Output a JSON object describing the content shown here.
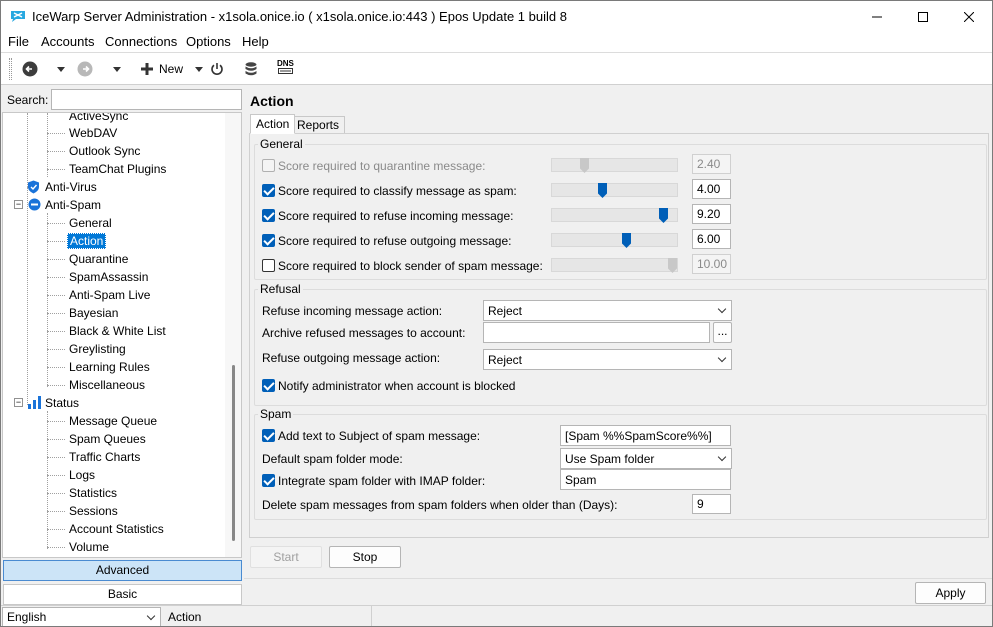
{
  "window": {
    "title": "IceWarp Server Administration - x1sola.onice.io ( x1sola.onice.io:443 ) Epos Update 1 build 8"
  },
  "menu": [
    "File",
    "Accounts",
    "Connections",
    "Options",
    "Help"
  ],
  "toolbar": {
    "new_label": "New",
    "dns_label": "DNS"
  },
  "search": {
    "label": "Search:",
    "value": ""
  },
  "tree": {
    "items": [
      {
        "label": "ActiveSync",
        "level": 2
      },
      {
        "label": "WebDAV",
        "level": 2
      },
      {
        "label": "Outlook Sync",
        "level": 2
      },
      {
        "label": "TeamChat Plugins",
        "level": 2
      },
      {
        "label": "Anti-Virus",
        "level": 1,
        "icon": "shield-icon"
      },
      {
        "label": "Anti-Spam",
        "level": 1,
        "icon": "no-entry-icon",
        "expanded": true
      },
      {
        "label": "General",
        "level": 2
      },
      {
        "label": "Action",
        "level": 2,
        "selected": true
      },
      {
        "label": "Quarantine",
        "level": 2
      },
      {
        "label": "SpamAssassin",
        "level": 2
      },
      {
        "label": "Anti-Spam Live",
        "level": 2
      },
      {
        "label": "Bayesian",
        "level": 2
      },
      {
        "label": "Black & White List",
        "level": 2
      },
      {
        "label": "Greylisting",
        "level": 2
      },
      {
        "label": "Learning Rules",
        "level": 2
      },
      {
        "label": "Miscellaneous",
        "level": 2
      },
      {
        "label": "Status",
        "level": 1,
        "icon": "bar-chart-icon",
        "expanded": true
      },
      {
        "label": "Message Queue",
        "level": 2
      },
      {
        "label": "Spam Queues",
        "level": 2
      },
      {
        "label": "Traffic Charts",
        "level": 2
      },
      {
        "label": "Logs",
        "level": 2
      },
      {
        "label": "Statistics",
        "level": 2
      },
      {
        "label": "Sessions",
        "level": 2
      },
      {
        "label": "Account Statistics",
        "level": 2
      },
      {
        "label": "Volume",
        "level": 2
      }
    ]
  },
  "mode_buttons": {
    "advanced": "Advanced",
    "basic": "Basic"
  },
  "page": {
    "title": "Action",
    "tabs": [
      "Action",
      "Reports"
    ],
    "active_tab": "Action"
  },
  "general": {
    "title": "General",
    "rows": [
      {
        "label": "Score required to quarantine message:",
        "checked": false,
        "disabled": true,
        "value": "2.40",
        "level": 0.24
      },
      {
        "label": "Score required to classify message as spam:",
        "checked": true,
        "disabled": false,
        "value": "4.00",
        "level": 0.4
      },
      {
        "label": "Score required to refuse incoming message:",
        "checked": true,
        "disabled": false,
        "value": "9.20",
        "level": 0.92
      },
      {
        "label": "Score required to refuse outgoing message:",
        "checked": true,
        "disabled": false,
        "value": "6.00",
        "level": 0.6
      },
      {
        "label": "Score required to block sender of spam message:",
        "checked": false,
        "disabled": false,
        "value": "10.00",
        "level": 1.0
      }
    ]
  },
  "refusal": {
    "title": "Refusal",
    "incoming_label": "Refuse incoming message action:",
    "incoming_value": "Reject",
    "archive_label": "Archive refused messages to account:",
    "archive_value": "",
    "browse_label": "...",
    "outgoing_label": "Refuse outgoing message action:",
    "outgoing_value": "Reject",
    "notify_label": "Notify administrator when account is blocked",
    "notify_checked": true
  },
  "spam": {
    "title": "Spam",
    "subject_label": "Add text to Subject of spam message:",
    "subject_checked": true,
    "subject_value": "[Spam %%SpamScore%%]",
    "folder_mode_label": "Default spam folder mode:",
    "folder_mode_value": "Use Spam folder",
    "imap_label": "Integrate spam folder with IMAP folder:",
    "imap_checked": true,
    "imap_value": "Spam",
    "delete_label": "Delete spam messages from spam folders when older than (Days):",
    "delete_value": "9"
  },
  "actions": {
    "start": "Start",
    "stop": "Stop",
    "apply": "Apply"
  },
  "status": {
    "language": "English",
    "text": "Action"
  }
}
